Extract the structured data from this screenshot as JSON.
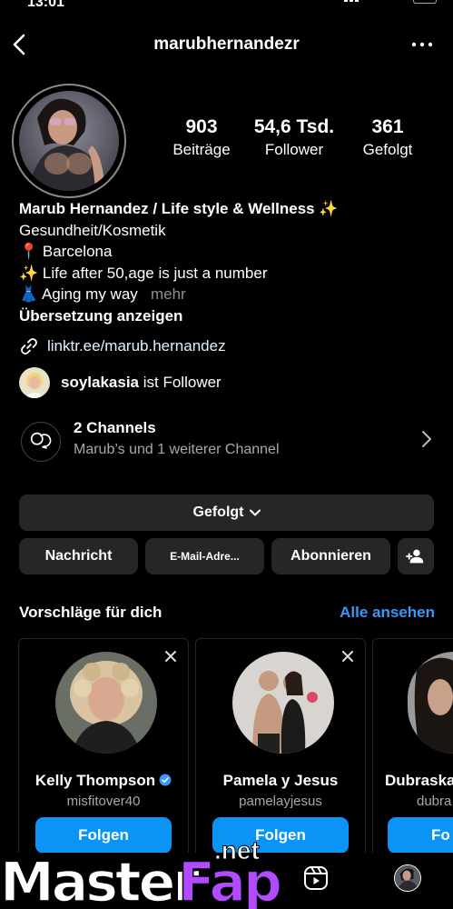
{
  "status": {
    "time": "13:01"
  },
  "header": {
    "username": "marubhernandezr"
  },
  "stats": [
    {
      "value": "903",
      "label": "Beiträge"
    },
    {
      "value": "54,6 Tsd.",
      "label": "Follower"
    },
    {
      "value": "361",
      "label": "Gefolgt"
    }
  ],
  "bio": {
    "name": "Marub Hernandez / Life style & Wellness ✨",
    "category": "Gesundheit/Kosmetik",
    "line_location": "📍 Barcelona",
    "line_age": "✨ Life after 50,age is just a number",
    "line_aging": "👗 Aging my way",
    "more": "mehr",
    "translate": "Übersetzung anzeigen"
  },
  "link": {
    "text": "linktr.ee/marub.hernandez"
  },
  "followed_by": {
    "username": "soylakasia",
    "suffix": "ist Follower"
  },
  "channels": {
    "title": "2 Channels",
    "subtitle": "Marub’s und 1 weiterer Channel"
  },
  "buttons": {
    "following": "Gefolgt",
    "message": "Nachricht",
    "email": "E-Mail-Adre...",
    "subscribe": "Abonnieren"
  },
  "suggestions": {
    "title": "Vorschläge für dich",
    "see_all": "Alle ansehen",
    "cards": [
      {
        "name": "Kelly Thompson",
        "handle": "misfitover40",
        "verified": true,
        "button": "Folgen"
      },
      {
        "name": "Pamela y Jesus",
        "handle": "pamelayjesus",
        "verified": false,
        "button": "Folgen"
      },
      {
        "name": "Dubraska",
        "handle": "dubra",
        "verified": false,
        "button": "Fo"
      }
    ]
  },
  "watermark": {
    "part1": "Master",
    "part2": "Fap",
    "part3": ".net"
  },
  "colors": {
    "accent": "#3a97f5",
    "follow_button": "#0a95f6",
    "button_bg": "#262626"
  }
}
